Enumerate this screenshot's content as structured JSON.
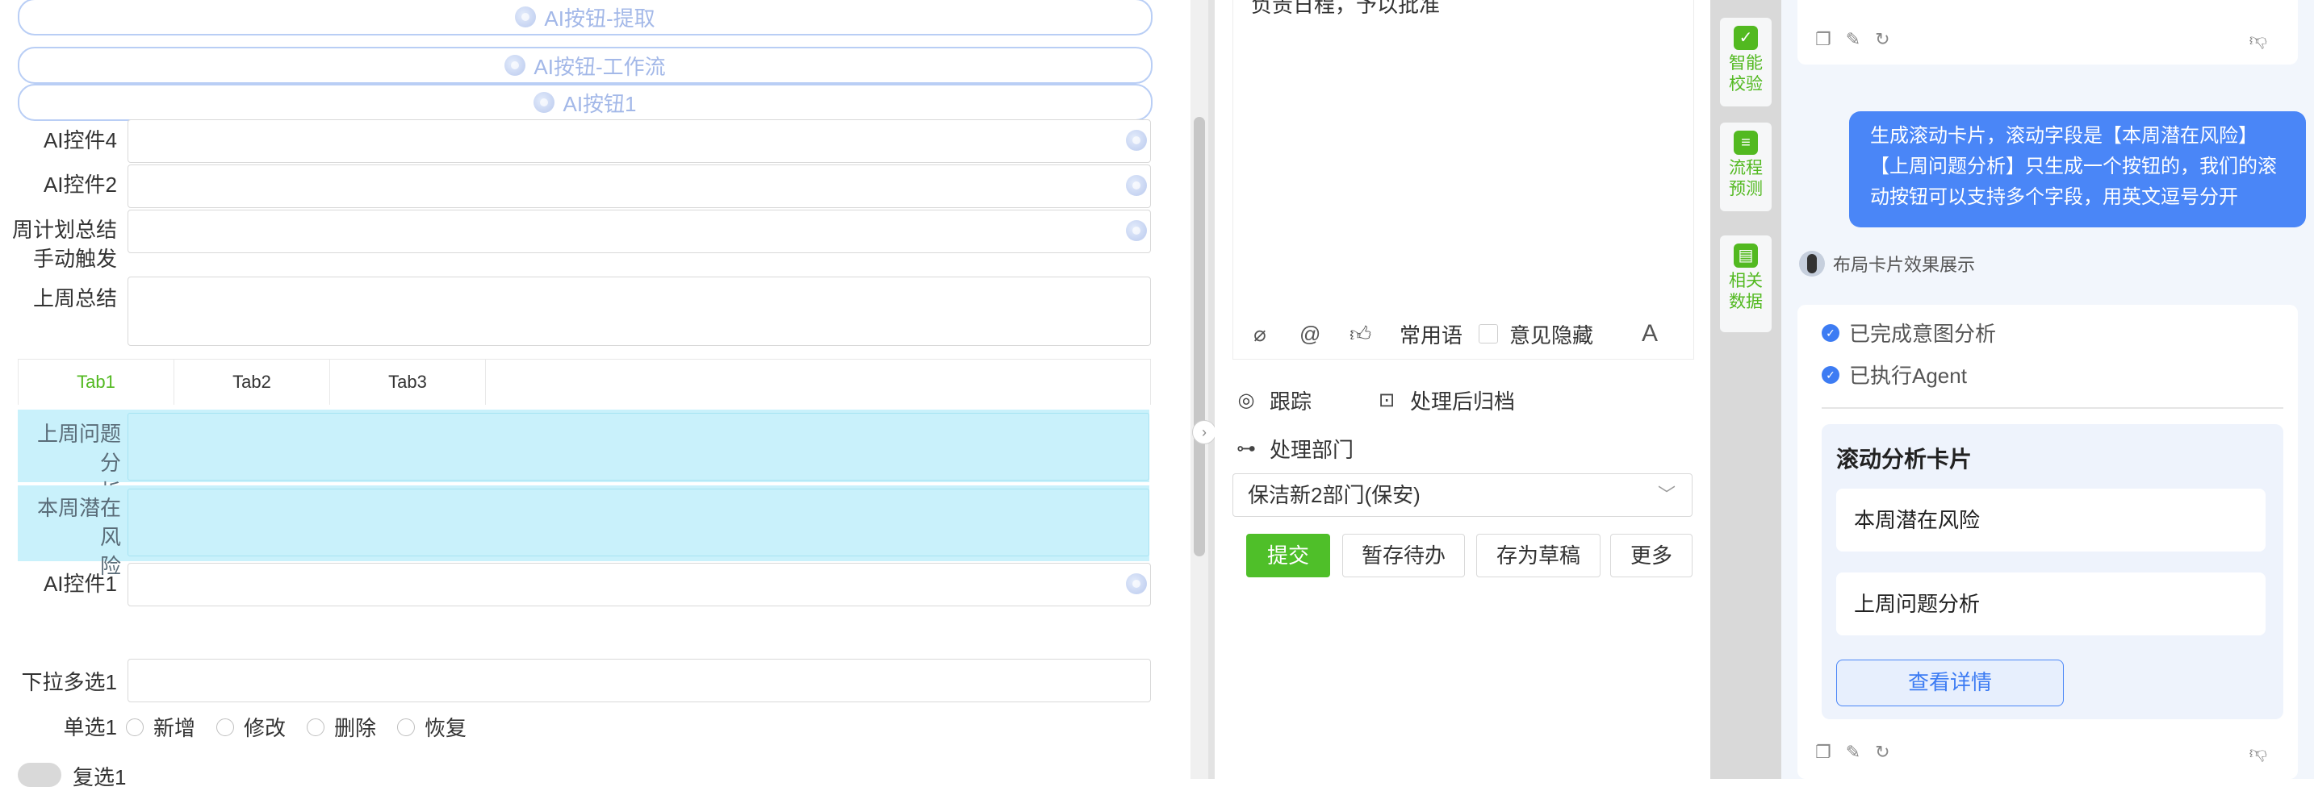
{
  "left_form": {
    "ai_buttons": [
      {
        "label": "AI按钮-提取"
      },
      {
        "label": "AI按钮-工作流"
      },
      {
        "label": "AI按钮1"
      }
    ],
    "fields": {
      "ai_ctrl4": "AI控件4",
      "ai_ctrl2": "AI控件2",
      "weekly_summary_line1": "周计划总结",
      "weekly_summary_line2": "手动触发",
      "last_week_summary": "上周总结",
      "ai_ctrl1": "AI控件1",
      "dropdown_multi": "下拉多选1",
      "single_select": "单选1",
      "checkbox": "复选1"
    },
    "tabs": [
      "Tab1",
      "Tab2",
      "Tab3"
    ],
    "active_tab": "Tab1",
    "highlighted_rows": [
      {
        "line1": "上周问题分",
        "line2": "析"
      },
      {
        "line1": "本周潜在风",
        "line2": "险"
      }
    ],
    "radio_options": [
      "新增",
      "修改",
      "删除",
      "恢复"
    ]
  },
  "middle": {
    "opinion_text_fragment": "负责日程，予以批准",
    "toolbar": {
      "common_phrases": "常用语",
      "hide_opinion": "意见隐藏",
      "font_glyph": "A"
    },
    "track": "跟踪",
    "archive": "处理后归档",
    "dept_label": "处理部门",
    "dept_value": "保洁新2部门(保安)",
    "buttons": {
      "submit": "提交",
      "save_todo": "暂存待办",
      "save_draft": "存为草稿",
      "more": "更多"
    }
  },
  "side_tools": [
    {
      "line1": "智能",
      "line2": "校验"
    },
    {
      "line1": "流程",
      "line2": "预测"
    },
    {
      "line1": "相关",
      "line2": "数据"
    }
  ],
  "chat": {
    "user_message": [
      "生成滚动卡片，滚动字段是【本周潜在风险】",
      "【上周问题分析】只生成一个按钮的，我们的滚",
      "动按钮可以支持多个字段，用英文逗号分开"
    ],
    "bot_name": "布局卡片效果展示",
    "steps": [
      "已完成意图分析",
      "已执行Agent"
    ],
    "card": {
      "title": "滚动分析卡片",
      "items": [
        "本周潜在风险",
        "上周问题分析"
      ],
      "detail_button": "查看详情"
    }
  },
  "colors": {
    "accent_green": "#52b920",
    "primary_blue": "#4a86f7",
    "highlight_cyan": "#c9f1fb"
  }
}
